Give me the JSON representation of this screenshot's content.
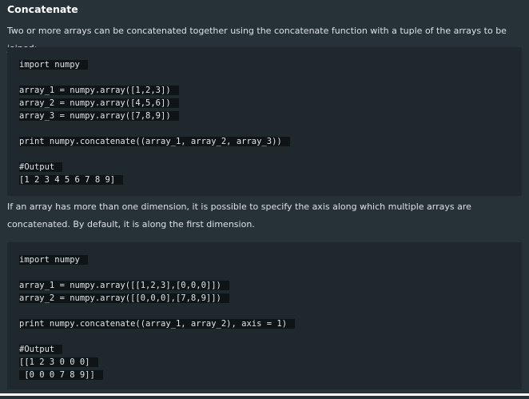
{
  "section": {
    "heading": "Concatenate",
    "intro": "Two or more arrays can be concatenated together using the concatenate function with a tuple of the arrays to be joined:",
    "axis_text": "If an array has more than one dimension, it is possible to specify the axis along which multiple arrays are concatenated. By default, it is along the first dimension."
  },
  "code_block_1": {
    "line1": "import numpy",
    "line2": "array_1 = numpy.array([1,2,3])",
    "line3": "array_2 = numpy.array([4,5,6])",
    "line4": "array_3 = numpy.array([7,8,9])",
    "line5": "print numpy.concatenate((array_1, array_2, array_3))",
    "line6": "#Output",
    "line7": "[1 2 3 4 5 6 7 8 9]"
  },
  "code_block_2": {
    "line1": "import numpy",
    "line2": "array_1 = numpy.array([[1,2,3],[0,0,0]])",
    "line3": "array_2 = numpy.array([[0,0,0],[7,8,9]])",
    "line4": "print numpy.concatenate((array_1, array_2), axis = 1)",
    "line5": "#Output",
    "line6": "[[1 2 3 0 0 0]",
    "line7": " [0 0 0 7 8 9]]"
  }
}
